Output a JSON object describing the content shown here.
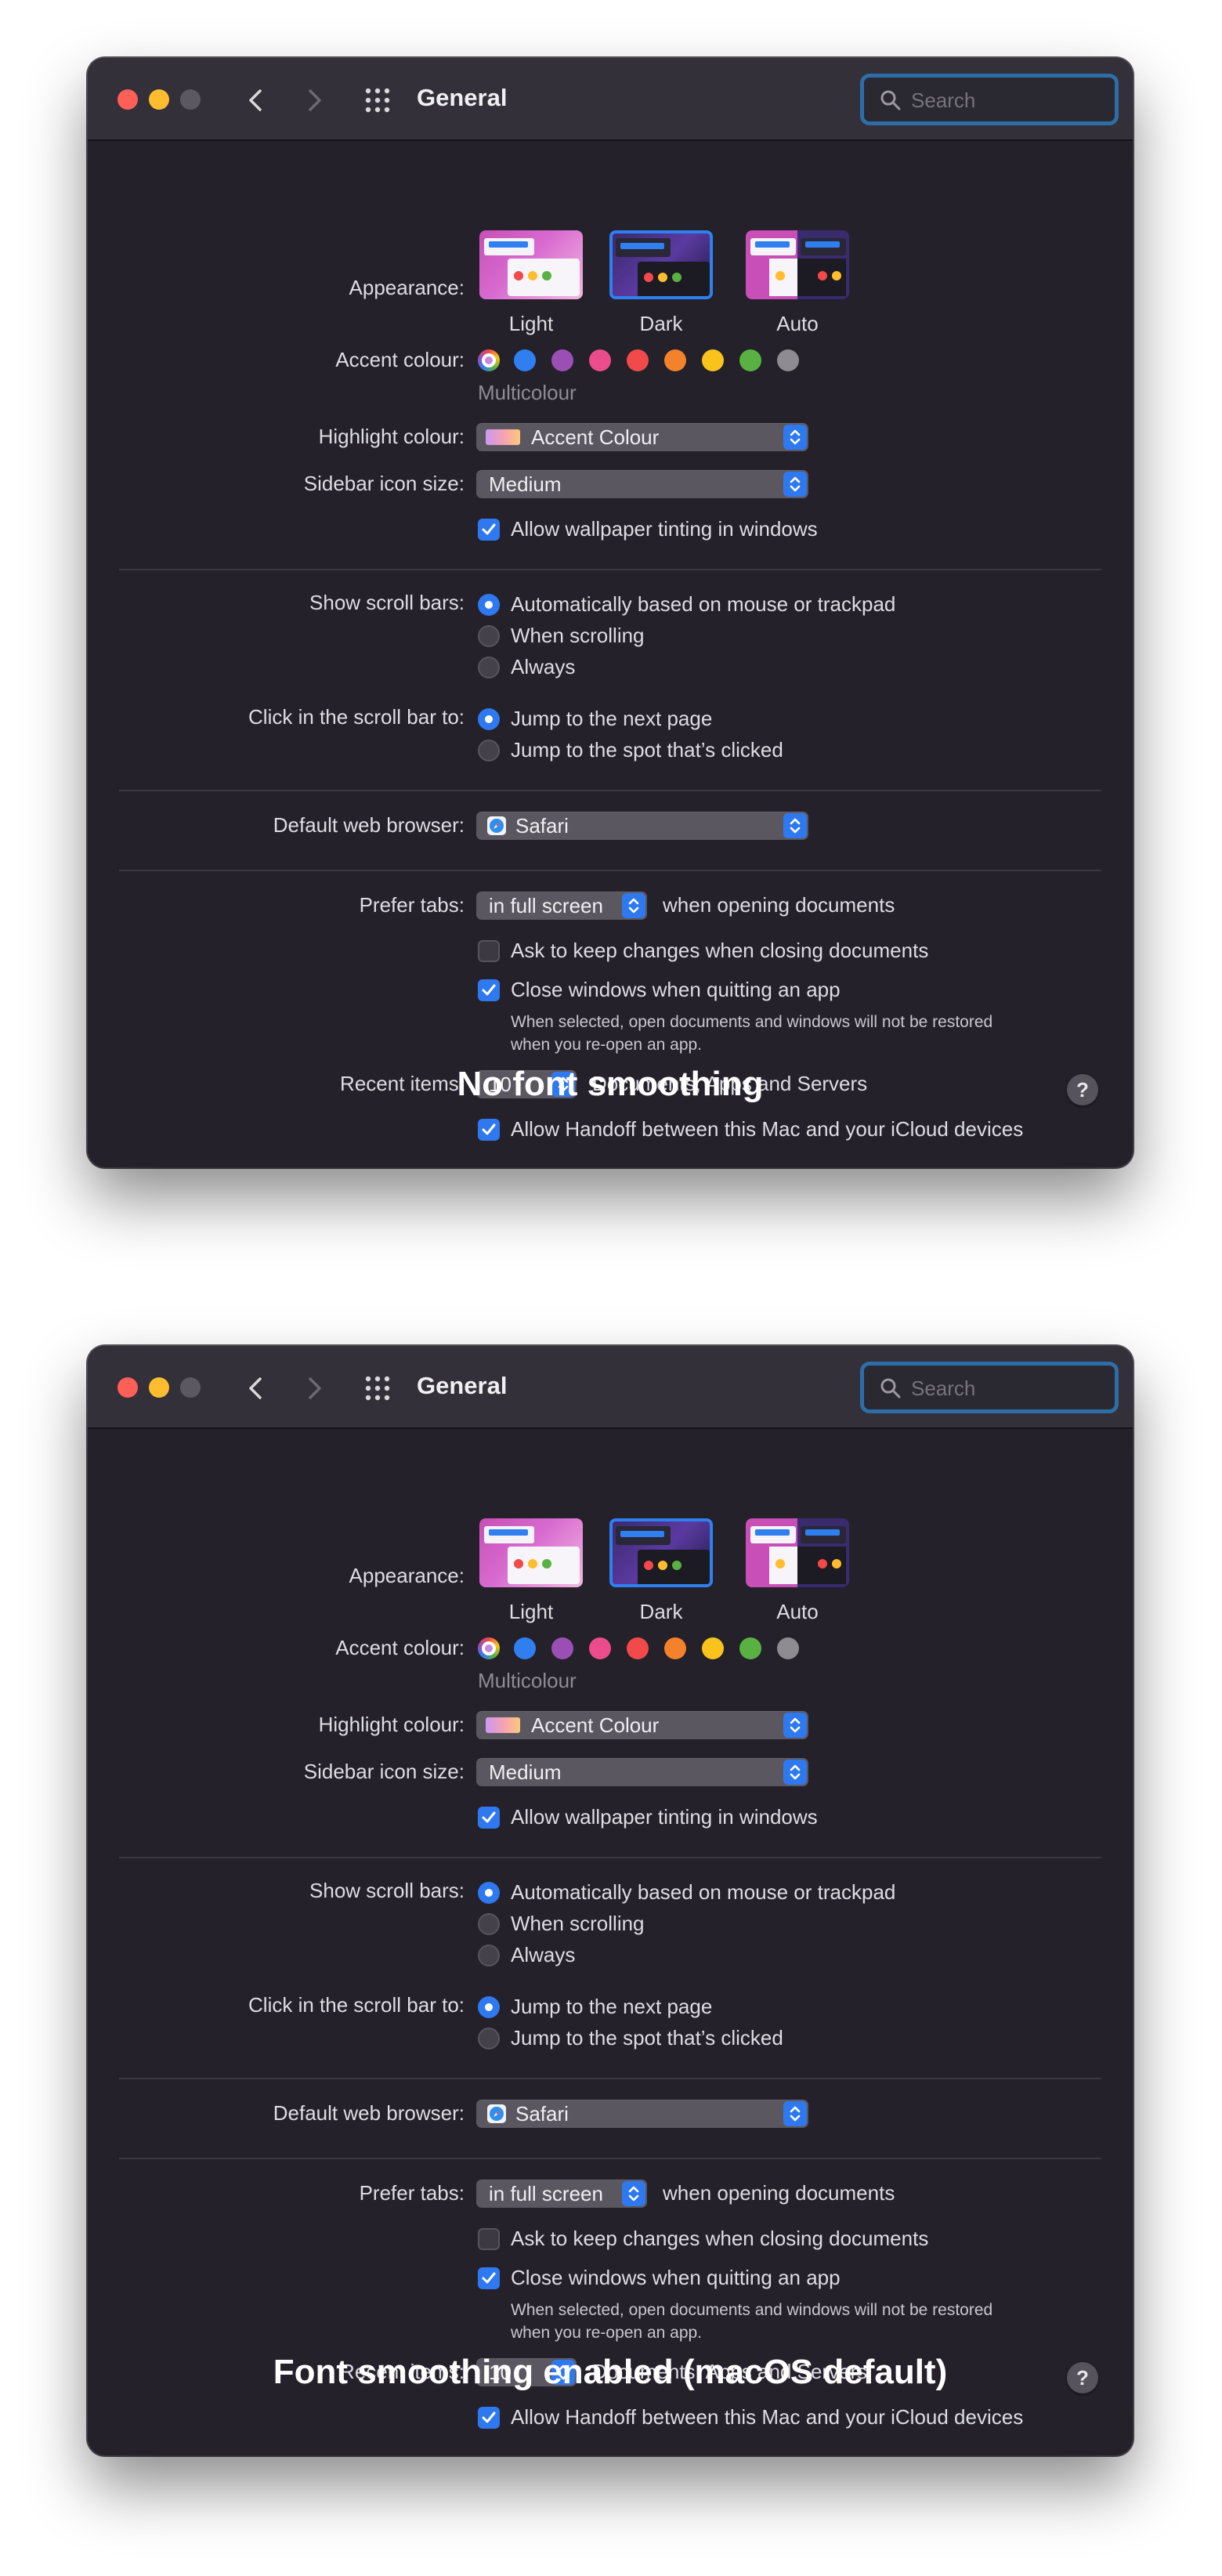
{
  "window": {
    "title": "General",
    "search_placeholder": "Search"
  },
  "appearance": {
    "label": "Appearance:",
    "options": [
      "Light",
      "Dark",
      "Auto"
    ],
    "selected": "Dark"
  },
  "accent": {
    "label": "Accent colour:",
    "selected_name": "Multicolour",
    "colors": [
      "#2f7ff0",
      "#9b4fb5",
      "#ea4c8c",
      "#f2494a",
      "#f4822a",
      "#f8c41c",
      "#5ab143",
      "#8e8c91"
    ]
  },
  "highlight": {
    "label": "Highlight colour:",
    "value": "Accent Colour"
  },
  "sidebar_icon": {
    "label": "Sidebar icon size:",
    "value": "Medium"
  },
  "wallpaper_tinting": {
    "label": "Allow wallpaper tinting in windows",
    "checked": true
  },
  "scroll_bars": {
    "label": "Show scroll bars:",
    "options": [
      "Automatically based on mouse or trackpad",
      "When scrolling",
      "Always"
    ],
    "selected": "Automatically based on mouse or trackpad"
  },
  "scroll_click": {
    "label": "Click in the scroll bar to:",
    "options": [
      "Jump to the next page",
      "Jump to the spot that’s clicked"
    ],
    "selected": "Jump to the next page"
  },
  "browser": {
    "label": "Default web browser:",
    "value": "Safari"
  },
  "prefer_tabs": {
    "label": "Prefer tabs:",
    "value": "in full screen",
    "suffix": "when opening documents"
  },
  "ask_keep_changes": {
    "label": "Ask to keep changes when closing documents",
    "checked": false
  },
  "close_windows": {
    "label": "Close windows when quitting an app",
    "checked": true,
    "note_line1": "When selected, open documents and windows will not be restored",
    "note_line2": "when you re-open an app."
  },
  "recent_items": {
    "label": "Recent items:",
    "value": "10",
    "suffix": "Documents, Apps and Servers"
  },
  "handoff": {
    "label": "Allow Handoff between this Mac and your iCloud devices",
    "checked": true
  },
  "help_label": "?",
  "captions": [
    "No font smoothing",
    "Font smoothing enabled (macOS default)"
  ]
}
